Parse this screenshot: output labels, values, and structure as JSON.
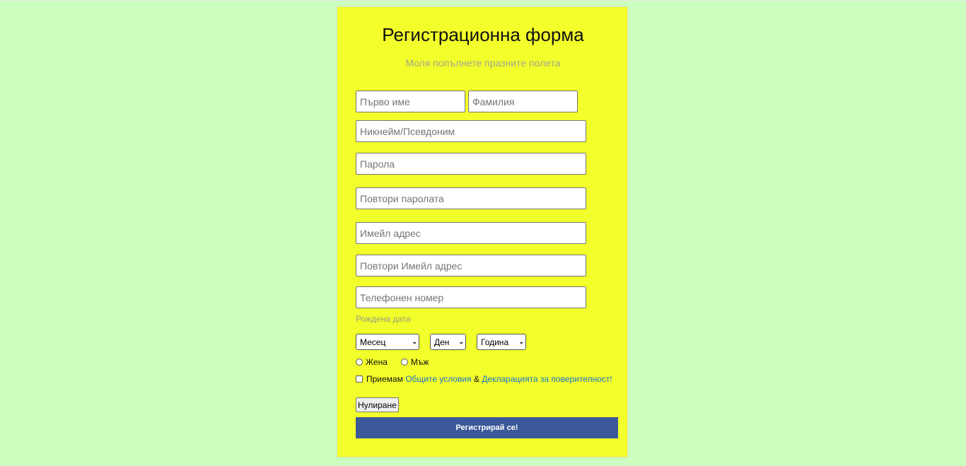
{
  "form": {
    "title": "Регистрационна форма",
    "subtitle": "Моля попълнете празните полета",
    "first_name_placeholder": "Първо име",
    "last_name_placeholder": "Фамилия",
    "nickname_placeholder": "Никнейм/Псевдоним",
    "password_placeholder": "Парола",
    "repeat_password_placeholder": "Повтори паролата",
    "email_placeholder": "Имейл адрес",
    "repeat_email_placeholder": "Повтори Имейл адрес",
    "phone_placeholder": "Телефонен номер",
    "dob_label": "Рождена дата",
    "month_selected": "Месец",
    "day_selected": "Ден",
    "year_selected": "Година",
    "gender_female": "Жена",
    "gender_male": "Мъж",
    "terms_prefix": "Приемам",
    "terms_link": "Общите условия",
    "terms_and": "&",
    "privacy_link": "Декларацията за поверителност!",
    "reset_label": "Нулиране",
    "submit_label": "Регистрирай се!"
  },
  "colors": {
    "page_background": "#ccffbf",
    "card_background": "#f2ff2a",
    "submit_background": "#3b5998",
    "link": "#1a73c8"
  }
}
